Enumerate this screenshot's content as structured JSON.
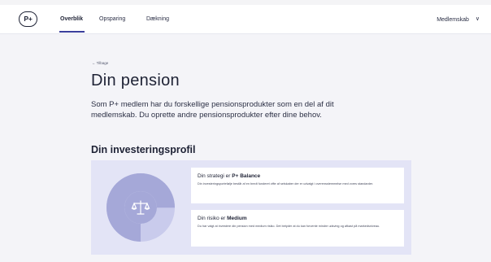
{
  "nav": {
    "logo": "P+",
    "items": [
      {
        "label": "Overblik"
      },
      {
        "label": "Opsparing"
      },
      {
        "label": "Dækning"
      }
    ],
    "membership_label": "Medlemskab",
    "accent_color": "#3a3e9c"
  },
  "page": {
    "back_label": "← Tilbage",
    "title": "Din pension",
    "intro": "Som P+ medlem har du forskellige pensionsprodukter som en del af dit medlemskab. Du oprette andre pensionsprodukter efter dine behov.",
    "profile_heading": "Din investeringsprofil"
  },
  "profile": {
    "icon": "scale-icon",
    "donut_fraction": 0.75,
    "colors": {
      "panel": "#e3e4f6",
      "ring_dark": "#a5a8d8",
      "ring_light": "#c9cbec"
    },
    "strategy": {
      "prefix": "Din strategi er ",
      "value": "P+ Balance",
      "text": "Din investeringsportefølje består af en bredt funderet vifte af selskaber der er udvalgt i overensstemmelse med vores standarder."
    },
    "risk": {
      "prefix": "Din risiko er ",
      "value": "Medium",
      "text": "Du har valgt at investere din pension med medium risiko. Det betyder at du kan forvente mindre udsving og afkast på markedsniveau."
    }
  }
}
